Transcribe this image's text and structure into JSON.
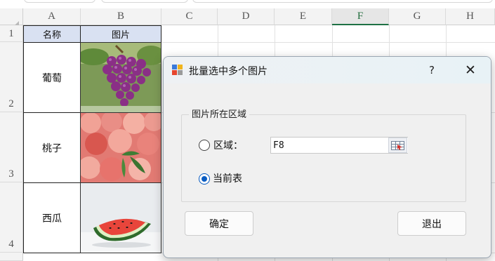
{
  "spreadsheet": {
    "columns": [
      "A",
      "B",
      "C",
      "D",
      "E",
      "F",
      "G",
      "H"
    ],
    "active_column": "F",
    "rows": [
      "1",
      "2",
      "3",
      "4"
    ],
    "header_row": {
      "name": "名称",
      "picture": "图片"
    },
    "items": [
      {
        "name": "葡萄",
        "picture": "grape-photo"
      },
      {
        "name": "桃子",
        "picture": "peach-photo"
      },
      {
        "name": "西瓜",
        "picture": "watermelon-photo"
      }
    ]
  },
  "dialog": {
    "title": "批量选中多个图片",
    "help_label": "?",
    "close_label": "✕",
    "group_label": "图片所在区域",
    "options": {
      "range_label": "区域：",
      "current_sheet_label": "当前表",
      "selected": "current_sheet"
    },
    "range_value": "F8",
    "ok_label": "确定",
    "exit_label": "退出"
  },
  "colors": {
    "header_fill": "#d9e1f2",
    "radio_accent": "#0a5cc2",
    "active_column_line": "#1e7145"
  }
}
